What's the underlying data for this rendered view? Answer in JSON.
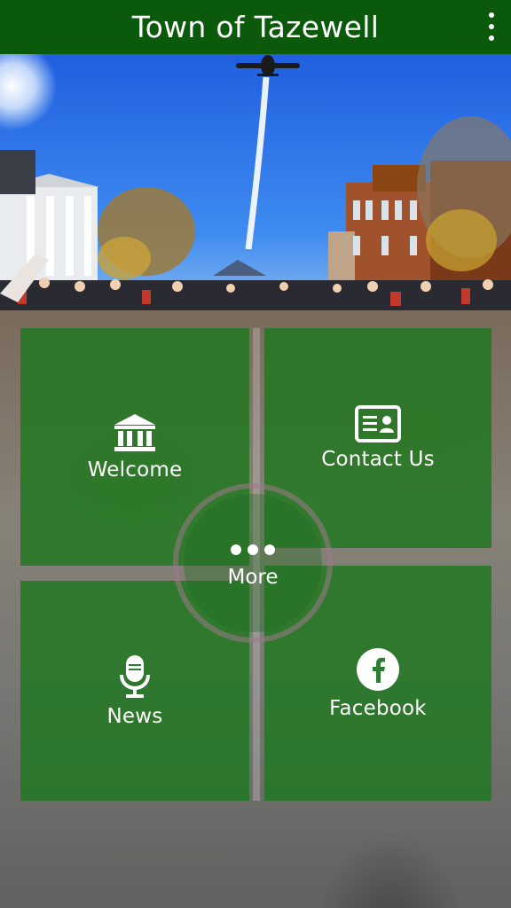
{
  "app_bar": {
    "title": "Town of Tazewell",
    "menu_icon": "more-vertical-icon"
  },
  "banner": {
    "alt": "banner-photo"
  },
  "tiles": [
    {
      "label": "Welcome",
      "icon": "building-icon"
    },
    {
      "label": "Contact Us",
      "icon": "contact-card-icon"
    },
    {
      "label": "News",
      "icon": "microphone-icon"
    },
    {
      "label": "Facebook",
      "icon": "facebook-icon"
    }
  ],
  "more": {
    "label": "More",
    "icon": "more-horizontal-icon"
  },
  "colors": {
    "app_bar": "#0b5a0b",
    "tile": "#1e781e",
    "text": "#ffffff"
  }
}
